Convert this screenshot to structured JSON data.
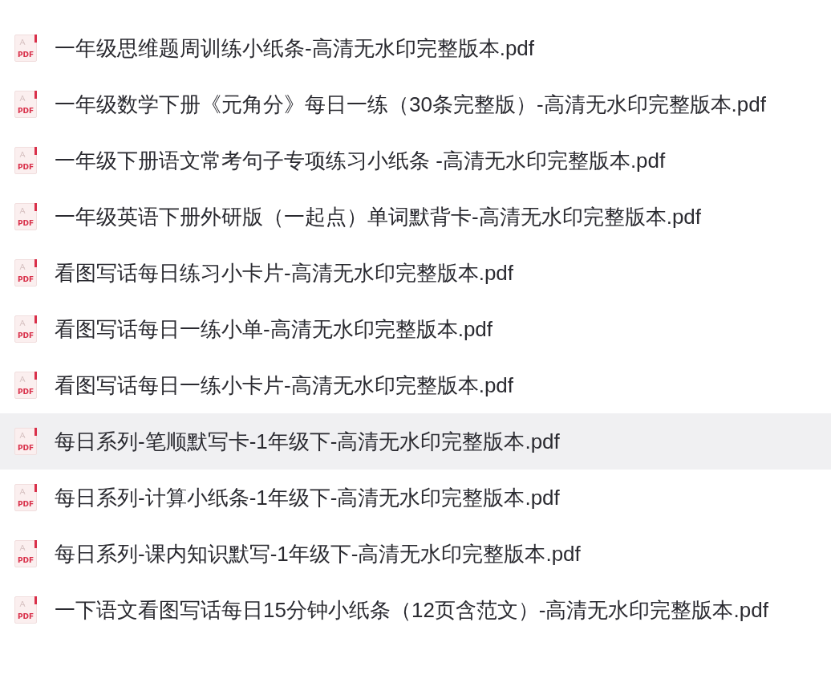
{
  "files": [
    {
      "name": "一年级思维题周训练小纸条-高清无水印完整版本.pdf",
      "icon_label": "PDF",
      "selected": false
    },
    {
      "name": "一年级数学下册《元角分》每日一练（30条完整版）-高清无水印完整版本.pdf",
      "icon_label": "PDF",
      "selected": false
    },
    {
      "name": "一年级下册语文常考句子专项练习小纸条 -高清无水印完整版本.pdf",
      "icon_label": "PDF",
      "selected": false
    },
    {
      "name": "一年级英语下册外研版（一起点）单词默背卡-高清无水印完整版本.pdf",
      "icon_label": "PDF",
      "selected": false
    },
    {
      "name": "看图写话每日练习小卡片-高清无水印完整版本.pdf",
      "icon_label": "PDF",
      "selected": false
    },
    {
      "name": "看图写话每日一练小单-高清无水印完整版本.pdf",
      "icon_label": "PDF",
      "selected": false
    },
    {
      "name": "看图写话每日一练小卡片-高清无水印完整版本.pdf",
      "icon_label": "PDF",
      "selected": false
    },
    {
      "name": "每日系列-笔顺默写卡-1年级下-高清无水印完整版本.pdf",
      "icon_label": "PDF",
      "selected": true
    },
    {
      "name": "每日系列-计算小纸条-1年级下-高清无水印完整版本.pdf",
      "icon_label": "PDF",
      "selected": false
    },
    {
      "name": "每日系列-课内知识默写-1年级下-高清无水印完整版本.pdf",
      "icon_label": "PDF",
      "selected": false
    },
    {
      "name": "一下语文看图写话每日15分钟小纸条（12页含范文）-高清无水印完整版本.pdf",
      "icon_label": "PDF",
      "selected": false
    }
  ]
}
